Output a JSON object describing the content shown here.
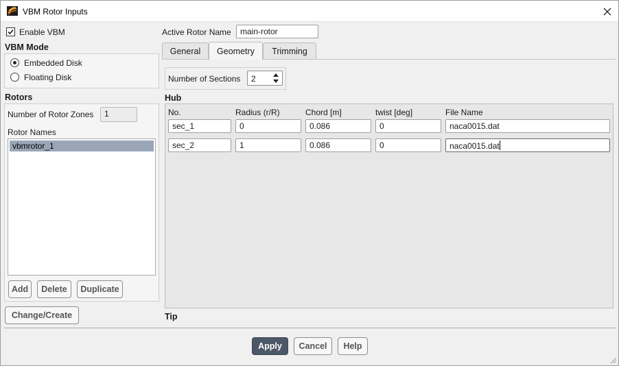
{
  "window": {
    "title": "VBM Rotor Inputs",
    "close_label": "✕",
    "icon": "app-icon"
  },
  "enable_vbm": {
    "label": "Enable VBM",
    "checked": true
  },
  "vbm_mode": {
    "title": "VBM Mode",
    "options": [
      {
        "label": "Embedded Disk",
        "selected": true
      },
      {
        "label": "Floating Disk",
        "selected": false
      }
    ]
  },
  "rotors": {
    "title": "Rotors",
    "zones_label": "Number of Rotor Zones",
    "zones_value": "1",
    "names_label": "Rotor Names",
    "names": [
      "vbmrotor_1"
    ],
    "buttons": {
      "add": "Add",
      "delete": "Delete",
      "duplicate": "Duplicate"
    }
  },
  "change_create_label": "Change/Create",
  "active_rotor": {
    "label": "Active Rotor Name",
    "value": "main-rotor"
  },
  "tabs": [
    {
      "label": "General",
      "active": false
    },
    {
      "label": "Geometry",
      "active": true
    },
    {
      "label": "Trimming",
      "active": false
    }
  ],
  "geometry": {
    "sections_label": "Number of Sections",
    "sections_value": "2",
    "hub_title": "Hub",
    "tip_title": "Tip",
    "columns": [
      "No.",
      "Radius (r/R)",
      "Chord [m]",
      "twist [deg]",
      "File Name"
    ],
    "rows": [
      {
        "no": "sec_1",
        "radius": "0",
        "chord": "0.086",
        "twist": "0",
        "file": "naca0015.dat"
      },
      {
        "no": "sec_2",
        "radius": "1",
        "chord": "0.086",
        "twist": "0",
        "file": "naca0015.dat"
      }
    ]
  },
  "footer": {
    "apply": "Apply",
    "cancel": "Cancel",
    "help": "Help"
  },
  "colors": {
    "primary_button": "#4c5767",
    "list_selection": "#9aa6b8"
  }
}
